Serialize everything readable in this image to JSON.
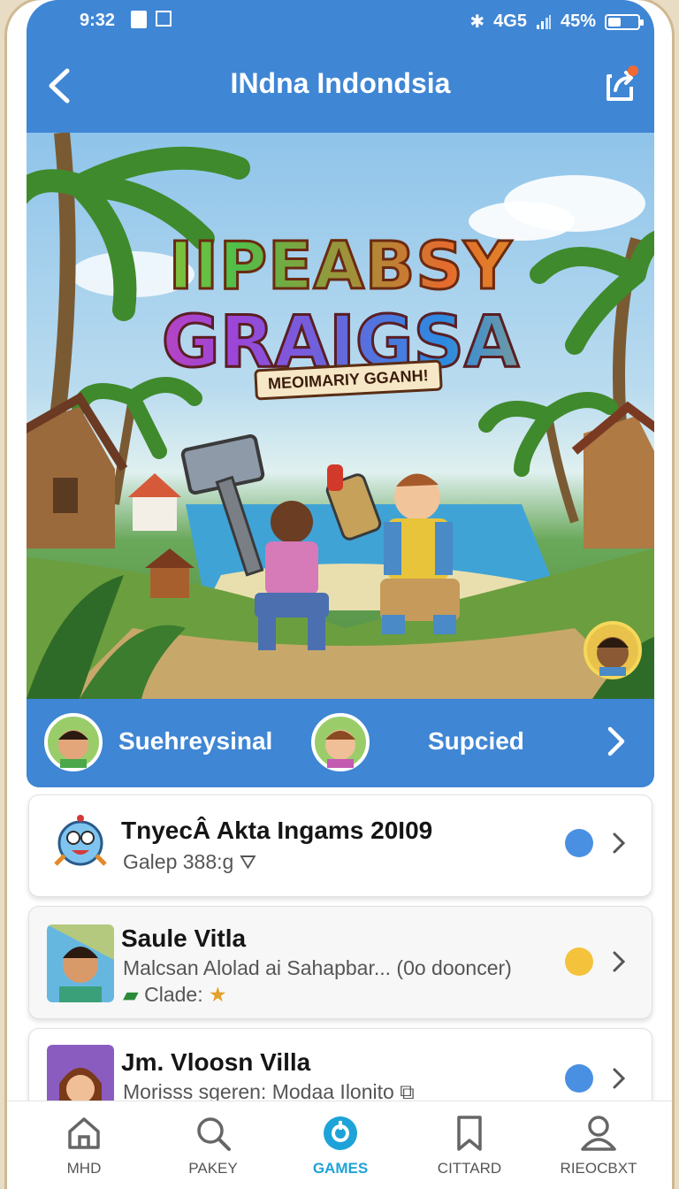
{
  "status_bar": {
    "time": "9:32",
    "signal_text": "4G5",
    "battery_percent": "45%",
    "battery_level": 0.45
  },
  "header": {
    "title": "INdna Indondsia",
    "back_icon": "chevron-left-icon",
    "share_icon": "share-icon"
  },
  "hero": {
    "title_line1": "IIPEABSY",
    "title_line2": "GRAIGSA",
    "subtitle": "MEOIMARIY GGANH!"
  },
  "tab_strip": {
    "items": [
      {
        "label": "Suehreysinal"
      },
      {
        "label": "Supcied"
      }
    ]
  },
  "list": {
    "items": [
      {
        "title": "TnyecÂ Akta Ingams 20I09",
        "subtitle": "Galep 388:g",
        "status_color": "#4a90e2"
      },
      {
        "title": "Saule Vitla",
        "subtitle": "Malcsan Alolad ai Sahapbar... (0o dooncer)",
        "extra": "Clade:",
        "status_color": "#f5c23c"
      },
      {
        "title": "Jm. Vloosn Villa",
        "subtitle": "Morisss sgeren: Modaa Ilonito",
        "status_color": "#4a90e2"
      }
    ]
  },
  "bottom_nav": {
    "items": [
      {
        "label": "MHD",
        "icon": "home-icon"
      },
      {
        "label": "PAKEY",
        "icon": "search-icon"
      },
      {
        "label": "GAMES",
        "icon": "games-icon",
        "active": true
      },
      {
        "label": "CITTARD",
        "icon": "bookmark-icon"
      },
      {
        "label": "RIEOCBXT",
        "icon": "profile-icon"
      }
    ]
  },
  "colors": {
    "primary": "#3f86d4",
    "active_nav": "#1ea3d8"
  }
}
